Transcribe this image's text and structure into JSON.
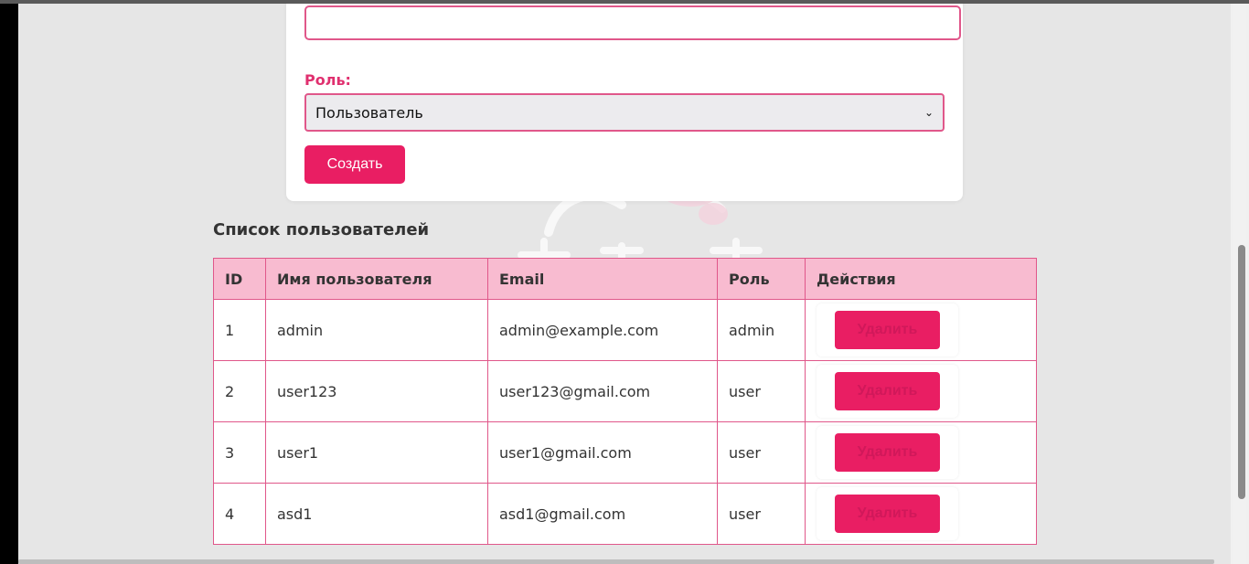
{
  "form": {
    "role_label": "Роль:",
    "role_selected": "Пользователь",
    "create_label": "Создать"
  },
  "users_section": {
    "title": "Список пользователей",
    "headers": [
      "ID",
      "Имя пользователя",
      "Email",
      "Роль",
      "Действия"
    ],
    "rows": [
      {
        "id": "1",
        "username": "admin",
        "email": "admin@example.com",
        "role": "admin",
        "action": "Удалить"
      },
      {
        "id": "2",
        "username": "user123",
        "email": "user123@gmail.com",
        "role": "user",
        "action": "Удалить"
      },
      {
        "id": "3",
        "username": "user1",
        "email": "user1@gmail.com",
        "role": "user",
        "action": "Удалить"
      },
      {
        "id": "4",
        "username": "asd1",
        "email": "asd1@gmail.com",
        "role": "user",
        "action": "Удалить"
      }
    ]
  },
  "colors": {
    "accent": "#e91e63",
    "table_header_bg": "#f8bbd0",
    "border": "#e0578a",
    "page_bg": "#e6e6e6"
  }
}
